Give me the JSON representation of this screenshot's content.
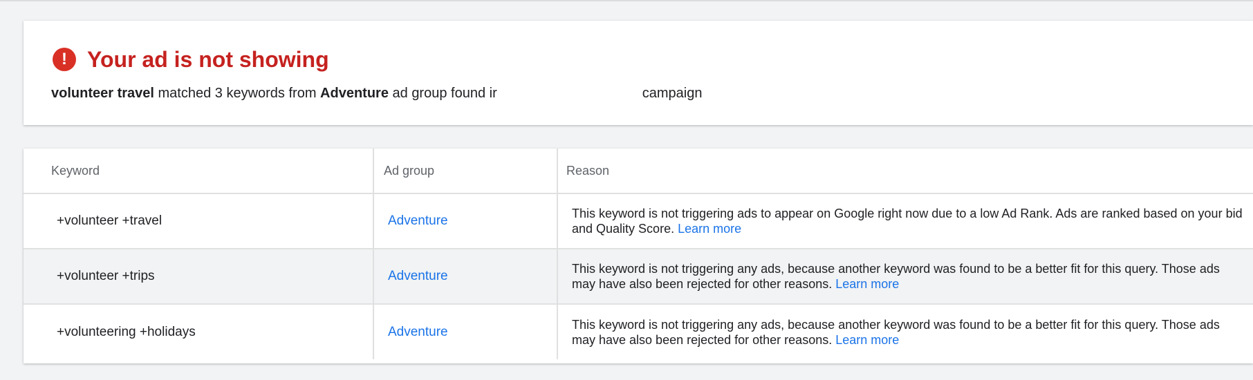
{
  "status": {
    "icon": "alert-icon",
    "icon_glyph": "!",
    "title": "Your ad is not showing",
    "title_color": "#c5221f",
    "query": "volunteer travel",
    "matched_text": " matched 3 keywords from ",
    "ad_group": "Adventure",
    "found_text": " ad group found ir",
    "campaign_text": "campaign"
  },
  "table": {
    "headers": {
      "keyword": "Keyword",
      "ad_group": "Ad group",
      "reason": "Reason"
    },
    "rows": [
      {
        "keyword": "+volunteer +travel",
        "ad_group": "Adventure",
        "reason": "This keyword is not triggering ads to appear on Google right now due to a low Ad Rank. Ads are ranked based on your bid and Quality Score.",
        "link": "Learn more"
      },
      {
        "keyword": "+volunteer +trips",
        "ad_group": "Adventure",
        "reason": "This keyword is not triggering any ads, because another keyword was found to be a better fit for this query. Those ads may have also been rejected for other reasons.",
        "link": "Learn more"
      },
      {
        "keyword": "+volunteering +holidays",
        "ad_group": "Adventure",
        "reason": "This keyword is not triggering any ads, because another keyword was found to be a better fit for this query. Those ads may have also been rejected for other reasons.",
        "link": "Learn more"
      }
    ]
  },
  "colors": {
    "link": "#1a73e8",
    "alert": "#d93025",
    "row_alt": "#f1f3f4"
  }
}
